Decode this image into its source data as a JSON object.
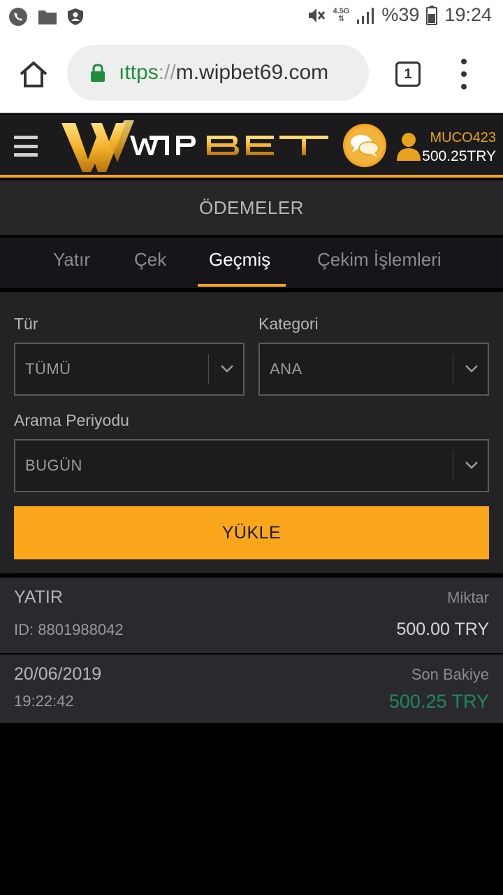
{
  "status_bar": {
    "network": "4.5G",
    "battery": "%39",
    "time": "19:24",
    "icons": [
      "phone-icon",
      "folder-icon",
      "shield-icon",
      "mute-icon",
      "signal-icon",
      "battery-icon"
    ]
  },
  "browser": {
    "url_scheme": "ıttps",
    "url_sep": "://",
    "url_host": "m.wipbet69.com",
    "tab_count": "1"
  },
  "header": {
    "brand": "WIPBET",
    "username": "MUCO423",
    "balance": "500.25TRY",
    "colors": {
      "accent": "#f9a61a",
      "header_bg": "#1b1b1d"
    }
  },
  "page": {
    "title": "ÖDEMELER"
  },
  "tabs": [
    {
      "label": "Yatır"
    },
    {
      "label": "Çek"
    },
    {
      "label": "Geçmiş",
      "active": true
    },
    {
      "label": "Çekim İşlemleri"
    }
  ],
  "filters": {
    "type_label": "Tür",
    "type_value": "TÜMÜ",
    "category_label": "Kategori",
    "category_value": "ANA",
    "period_label": "Arama Periyodu",
    "period_value": "BUGÜN",
    "load_button": "YÜKLE"
  },
  "transactions": [
    {
      "type": "YATIR",
      "id": "ID: 8801988042",
      "amount_label": "Miktar",
      "amount": "500.00 TRY"
    },
    {
      "date": "20/06/2019",
      "time": "19:22:42",
      "balance_label": "Son Bakiye",
      "balance": "500.25 TRY",
      "balance_color": "#1f8a5c"
    }
  ]
}
